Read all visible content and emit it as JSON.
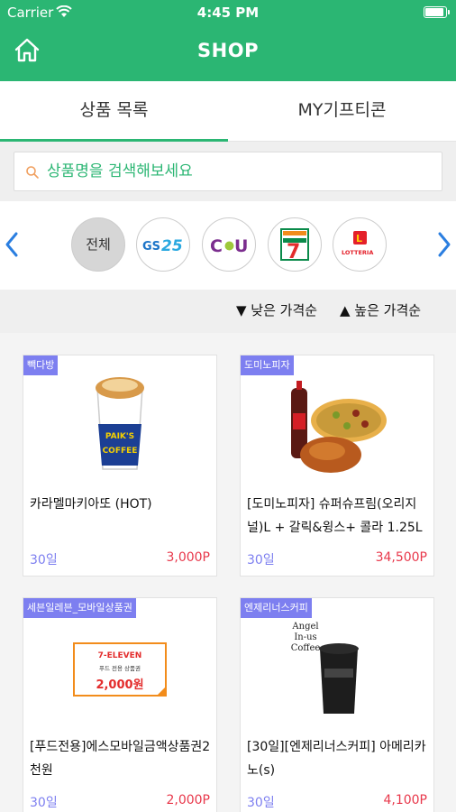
{
  "status_bar": {
    "carrier": "Carrier",
    "time": "4:45 PM"
  },
  "header": {
    "title": "SHOP",
    "home_icon": "home-icon"
  },
  "tabs": [
    {
      "label": "상품 목록",
      "active": true
    },
    {
      "label": "MY기프티콘",
      "active": false
    }
  ],
  "search": {
    "placeholder": "상품명을 검색해보세요",
    "value": ""
  },
  "brands": {
    "items": [
      {
        "label": "전체",
        "selected": true
      },
      {
        "label": "GS25"
      },
      {
        "label": "CU"
      },
      {
        "label": "7-ELEVEN"
      },
      {
        "label": "LOTTERIA"
      }
    ]
  },
  "sort": {
    "low": "▼ 낮은 가격순",
    "high": "▲ 높은 가격순"
  },
  "products": [
    {
      "brand": "빽다방",
      "name": "카라멜마키아또 (HOT)",
      "validity": "30일",
      "price": "3,000P"
    },
    {
      "brand": "도미노피자",
      "name": "[도미노피자] 슈퍼슈프림(오리지널)L + 갈릭&윙스+ 콜라 1.25L",
      "validity": "30일",
      "price": "34,500P"
    },
    {
      "brand": "세븐일레븐_모바일상품권",
      "name": "[푸드전용]에스모바일금액상품권2천원",
      "validity": "30일",
      "price": "2,000P",
      "voucher_brand": "7-ELEVEN",
      "voucher_sub": "푸드 전용 상품권",
      "voucher_amount": "2,000원"
    },
    {
      "brand": "엔제리너스커피",
      "name": "[30일][엔제리너스커피] 아메리카노(s)",
      "validity": "30일",
      "price": "4,100P",
      "logo_text": "Angel in-us Coffee"
    }
  ],
  "colors": {
    "primary": "#2bb673",
    "badge": "#7d7ff0",
    "price": "#e8384b",
    "arrow": "#2a7ee0"
  }
}
